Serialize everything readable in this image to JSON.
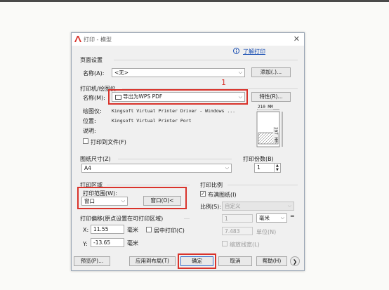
{
  "window": {
    "title": "打印 - 模型",
    "close_glyph": "✕",
    "help_link": "了解打印"
  },
  "page_setup": {
    "group_title": "页面设置",
    "name_label": "名称(A):",
    "name_value": "<无>",
    "add_button": "添加(.)..."
  },
  "printer": {
    "group_title": "打印机/绘图仪",
    "name_label": "名称(M):",
    "name_value": "导出为WPS PDF",
    "properties_button": "特性(R)...",
    "plotter_label": "绘图仪:",
    "plotter_value": "Kingsoft Virtual Printer Driver - Windows ...",
    "location_label": "位置:",
    "location_value": "Kingsoft Virtual Printer Port",
    "description_label": "说明:",
    "print_to_file_label": "打印到文件(F)",
    "print_to_file_checked": false,
    "preview_width_label": "210 MM",
    "preview_height_label": "297 MM",
    "annotation_number": "1"
  },
  "paper_size": {
    "group_title": "图纸尺寸(Z)",
    "value": "A4"
  },
  "copies": {
    "label": "打印份数(B)",
    "value": "1"
  },
  "print_area": {
    "group_title": "打印区域",
    "range_label": "打印范围(W):",
    "range_value": "窗口",
    "window_button": "窗口(O)<"
  },
  "print_offset": {
    "group_title": "打印偏移(原点设置在可打印区域)",
    "x_label": "X:",
    "x_value": "11.55",
    "y_label": "Y:",
    "y_value": "-13.65",
    "unit_x": "毫米",
    "unit_y": "毫米",
    "center_label": "居中打印(C)",
    "center_checked": false
  },
  "scale": {
    "group_title": "打印比例",
    "fit_label": "布满图纸(I)",
    "fit_checked": true,
    "ratio_label": "比例(S):",
    "ratio_value": "自定义",
    "value1": "1",
    "unit1": "毫米",
    "equals": "=",
    "value2": "7.483",
    "unit2": "单位(N)",
    "lineweights_label": "缩放线宽(L)",
    "lineweights_checked": false
  },
  "footer": {
    "preview_button": "预览(P)...",
    "apply_layout_button": "应用到布局(T)",
    "ok_button": "确定",
    "cancel_button": "取消",
    "help_button": "帮助(H)",
    "more_glyph": "❯"
  },
  "colors": {
    "highlight_red": "#d9332b",
    "link_blue": "#1a4fb3",
    "dialog_bg": "#f0f0f0"
  }
}
